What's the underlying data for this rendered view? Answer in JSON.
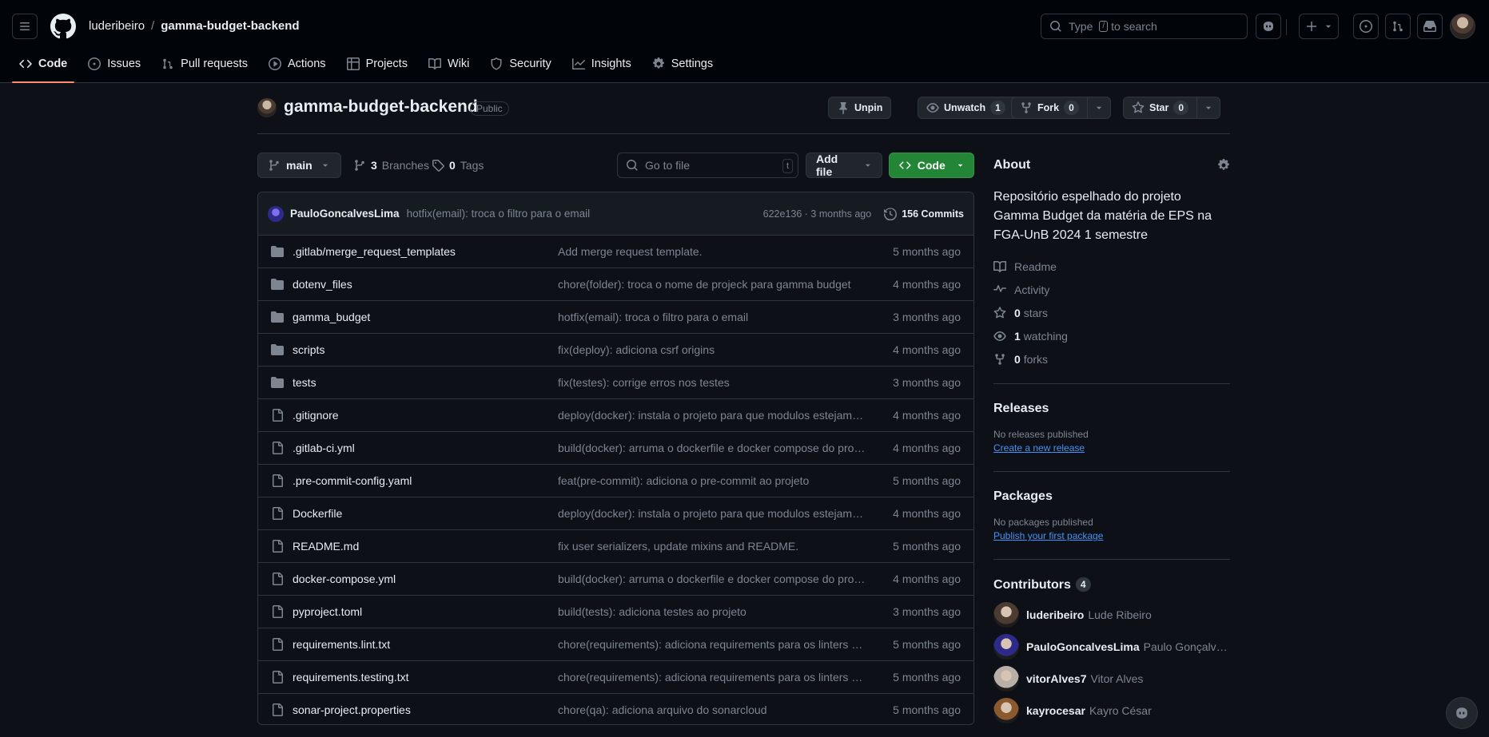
{
  "header": {
    "owner": "luderibeiro",
    "separator": "/",
    "repo": "gamma-budget-backend",
    "search_prefix": "Type",
    "search_key": "/",
    "search_suffix": "to search"
  },
  "nav": {
    "tabs": [
      {
        "label": "Code",
        "icon": "code-icon",
        "active": true
      },
      {
        "label": "Issues",
        "icon": "issue-opened-icon"
      },
      {
        "label": "Pull requests",
        "icon": "git-pull-request-icon"
      },
      {
        "label": "Actions",
        "icon": "play-icon"
      },
      {
        "label": "Projects",
        "icon": "table-icon"
      },
      {
        "label": "Wiki",
        "icon": "book-icon"
      },
      {
        "label": "Security",
        "icon": "shield-icon"
      },
      {
        "label": "Insights",
        "icon": "graph-icon"
      },
      {
        "label": "Settings",
        "icon": "gear-icon"
      }
    ]
  },
  "repo_head": {
    "title": "gamma-budget-backend",
    "visibility": "Public",
    "unpin": "Unpin",
    "unwatch": "Unwatch",
    "watch_count": "1",
    "fork": "Fork",
    "fork_count": "0",
    "star": "Star",
    "star_count": "0"
  },
  "toolbar": {
    "branch": "main",
    "branches_count": "3",
    "branches_label": "Branches",
    "tags_count": "0",
    "tags_label": "Tags",
    "goto_placeholder": "Go to file",
    "goto_key": "t",
    "add_file": "Add file",
    "code": "Code"
  },
  "latest_commit": {
    "author": "PauloGoncalvesLima",
    "message": "hotfix(email): troca o filtro para o email",
    "sha_time": "622e136 · 3 months ago",
    "commits": "156 Commits"
  },
  "files": [
    {
      "type": "dir",
      "name": ".gitlab/merge_request_templates",
      "msg": "Add merge request template.",
      "date": "5 months ago"
    },
    {
      "type": "dir",
      "name": "dotenv_files",
      "msg": "chore(folder): troca o nome de projeck para gamma budget",
      "date": "4 months ago"
    },
    {
      "type": "dir",
      "name": "gamma_budget",
      "msg": "hotfix(email): troca o filtro para o email",
      "date": "3 months ago"
    },
    {
      "type": "dir",
      "name": "scripts",
      "msg": "fix(deploy): adiciona csrf origins",
      "date": "4 months ago"
    },
    {
      "type": "dir",
      "name": "tests",
      "msg": "fix(testes): corrige erros nos testes",
      "date": "3 months ago"
    },
    {
      "type": "file",
      "name": ".gitignore",
      "msg": "deploy(docker): instala o projeto para que modulos estejam …",
      "date": "4 months ago"
    },
    {
      "type": "file",
      "name": ".gitlab-ci.yml",
      "msg": "build(docker): arruma o dockerfile e docker compose do pro…",
      "date": "4 months ago"
    },
    {
      "type": "file",
      "name": ".pre-commit-config.yaml",
      "msg": "feat(pre-commit): adiciona o pre-commit ao projeto",
      "date": "5 months ago"
    },
    {
      "type": "file",
      "name": "Dockerfile",
      "msg": "deploy(docker): instala o projeto para que modulos estejam …",
      "date": "4 months ago"
    },
    {
      "type": "file",
      "name": "README.md",
      "msg": "fix user serializers, update mixins and README.",
      "date": "5 months ago"
    },
    {
      "type": "file",
      "name": "docker-compose.yml",
      "msg": "build(docker): arruma o dockerfile e docker compose do pro…",
      "date": "4 months ago"
    },
    {
      "type": "file",
      "name": "pyproject.toml",
      "msg": "build(tests): adiciona testes ao projeto",
      "date": "3 months ago"
    },
    {
      "type": "file",
      "name": "requirements.lint.txt",
      "msg": "chore(requirements): adiciona requirements para os linters e…",
      "date": "5 months ago"
    },
    {
      "type": "file",
      "name": "requirements.testing.txt",
      "msg": "chore(requirements): adiciona requirements para os linters e…",
      "date": "5 months ago"
    },
    {
      "type": "file",
      "name": "sonar-project.properties",
      "msg": "chore(qa): adiciona arquivo do sonarcloud",
      "date": "5 months ago"
    }
  ],
  "about": {
    "title": "About",
    "description": "Repositório espelhado do projeto Gamma Budget da matéria de EPS na FGA-UnB 2024 1 semestre",
    "readme": "Readme",
    "activity": "Activity",
    "stars_count": "0",
    "stars_label": "stars",
    "watching_count": "1",
    "watching_label": "watching",
    "forks_count": "0",
    "forks_label": "forks"
  },
  "releases": {
    "title": "Releases",
    "text": "No releases published",
    "link": "Create a new release"
  },
  "packages": {
    "title": "Packages",
    "text": "No packages published",
    "link": "Publish your first package"
  },
  "contributors": {
    "title": "Contributors",
    "count": "4",
    "list": [
      {
        "login": "luderibeiro",
        "name": "Lude Ribeiro",
        "color": "#4b3b30"
      },
      {
        "login": "PauloGoncalvesLima",
        "name": "Paulo Gonçalves L…",
        "color": "#2d2a8a"
      },
      {
        "login": "vitorAlves7",
        "name": "Vitor Alves",
        "color": "#b8b0a8"
      },
      {
        "login": "kayrocesar",
        "name": "Kayro César",
        "color": "#8a5a2e"
      }
    ]
  },
  "colors": {
    "bg": "#0d1117",
    "header_bg": "#010409",
    "border": "#30363d",
    "muted": "#7d8590",
    "accent_green": "#238636",
    "link_blue": "#4493f8",
    "tab_underline": "#fd8c73"
  }
}
